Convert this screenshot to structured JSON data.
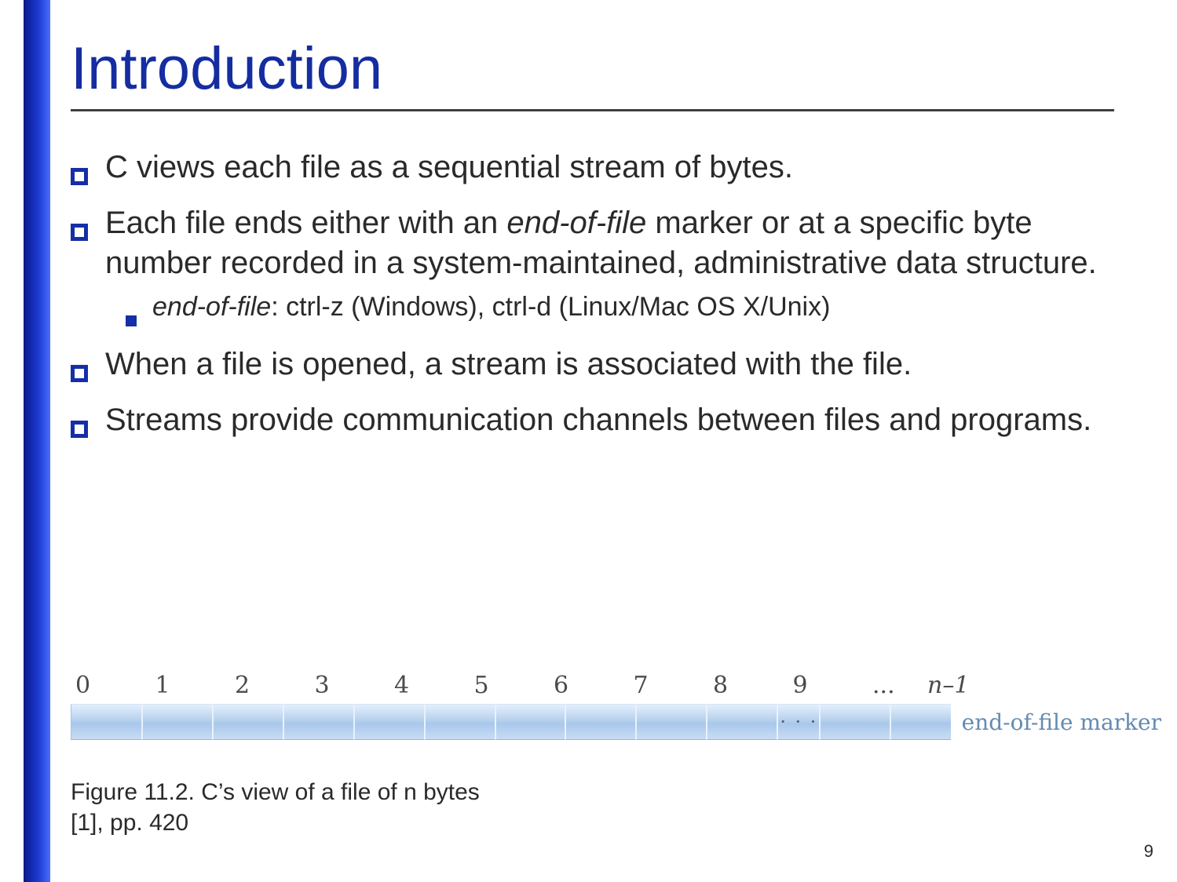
{
  "slide": {
    "title": "Introduction",
    "page_number": "9"
  },
  "bullets": {
    "b1": "C views each file as a sequential stream of bytes.",
    "b2_prefix": "Each file ends either with an ",
    "b2_em": "end-of-file",
    "b2_suffix": " marker or at a specific byte number recorded in a system-maintained, administrative data structure.",
    "b2_sub_em": "end-of-file",
    "b2_sub_rest": ": ctrl-z (Windows), ctrl-d (Linux/Mac OS X/Unix)",
    "b3": "When a file is opened, a stream is associated with the file.",
    "b4": "Streams provide communication channels between files and programs."
  },
  "figure": {
    "labels": [
      "0",
      "1",
      "2",
      "3",
      "4",
      "5",
      "6",
      "7",
      "8",
      "9",
      "..."
    ],
    "n_minus_1_n": "n",
    "n_minus_1_suffix": "–1",
    "ellipsis_cell": "· · ·",
    "eof_text": "end-of-file marker",
    "caption_line1": "Figure 11.2. C’s view of a file of n bytes",
    "caption_line2": "[1], pp. 420"
  }
}
